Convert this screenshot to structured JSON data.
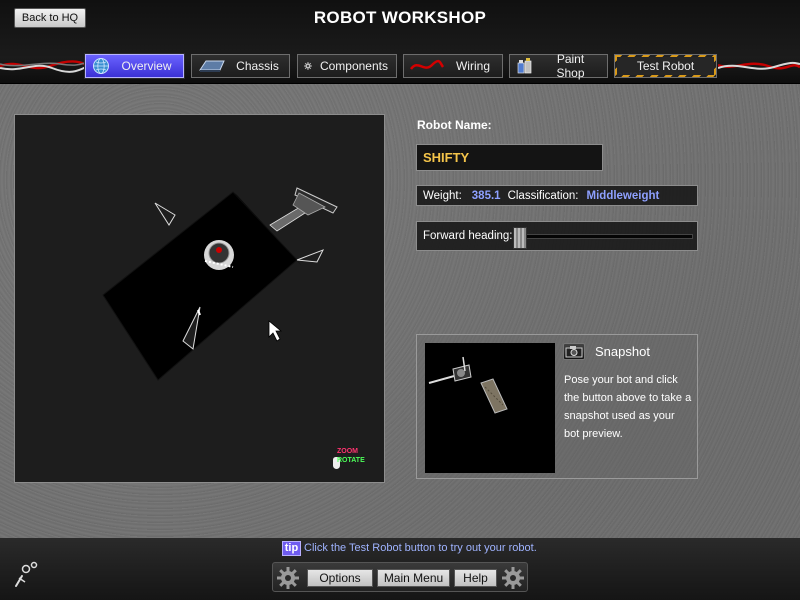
{
  "header": {
    "back_label": "Back to HQ",
    "title": "ROBOT WORKSHOP"
  },
  "tabs": [
    {
      "label": "Overview",
      "icon": "globe-icon",
      "active": true
    },
    {
      "label": "Chassis",
      "icon": "chassis-icon",
      "active": false
    },
    {
      "label": "Components",
      "icon": "gear-icon",
      "active": false
    },
    {
      "label": "Wiring",
      "icon": "wire-icon",
      "active": false
    },
    {
      "label": "Paint Shop",
      "icon": "paint-icon",
      "active": false
    },
    {
      "label": "Test Robot",
      "icon": "",
      "active": false
    }
  ],
  "viewport": {
    "zoom_label": "ZOOM",
    "rotate_label": "ROTATE"
  },
  "robot": {
    "name_label": "Robot Name:",
    "name_value": "SHIFTY",
    "weight_label": "Weight:",
    "weight_value": "385.1",
    "class_label": "Classification:",
    "class_value": "Middleweight",
    "heading_label": "Forward heading:"
  },
  "snapshot": {
    "title": "Snapshot",
    "description": "Pose your bot and click the button above to take a snapshot used as your bot preview."
  },
  "footer": {
    "tip_badge": "tip",
    "tip_text": "Click the Test Robot button to try out your robot.",
    "options_label": "Options",
    "main_menu_label": "Main Menu",
    "help_label": "Help"
  },
  "colors": {
    "accent": "#4a40e8",
    "name_text": "#f4c44a",
    "stat_value": "#8ea0ff",
    "tip_text": "#9fb3ff"
  }
}
